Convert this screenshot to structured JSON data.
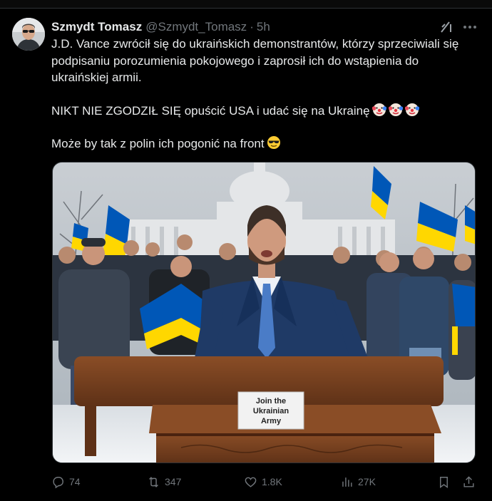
{
  "author": {
    "name": "Szmydt Tomasz",
    "handle": "@Szmydt_Tomasz",
    "separator": "·",
    "time": "5h"
  },
  "tweet": {
    "line1": "J.D. Vance zwrócił się do ukraińskich demonstrantów, którzy sprzeciwiali się podpisaniu porozumienia pokojowego i zaprosił ich do wstąpienia do ukraińskiej armii.",
    "line2": "NIKT NIE ZGODZIŁ SIĘ opuścić USA i udać się na Ukrainę",
    "line3": "Może by tak z polin ich pogonić na front",
    "emoji_line2": [
      "clown-face",
      "clown-face",
      "clown-face"
    ],
    "emoji_line3": [
      "sunglasses-face"
    ]
  },
  "media": {
    "sign_text_1": "Join the",
    "sign_text_2": "Ukrainian",
    "sign_text_3": "Army"
  },
  "actions": {
    "replies": "74",
    "reposts": "347",
    "likes": "1.8K",
    "views": "27K"
  },
  "colors": {
    "background": "#000000",
    "text": "#e7e9ea",
    "muted": "#71767b",
    "flag_blue": "#0057b7",
    "flag_yellow": "#ffd700"
  }
}
